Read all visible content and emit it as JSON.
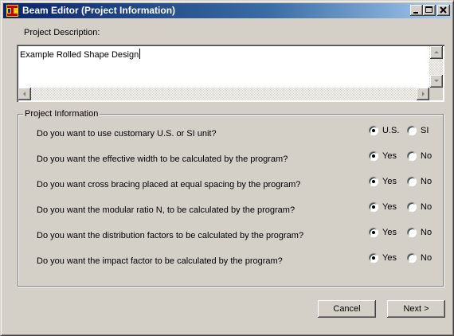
{
  "window": {
    "title": "Beam Editor (Project Information)",
    "icons": {
      "app": "beam-app-icon",
      "minimize": "minimize-icon",
      "maximize": "maximize-icon",
      "close": "close-icon"
    }
  },
  "project_description": {
    "label": "Project Description:",
    "value": "Example Rolled Shape Design"
  },
  "project_information": {
    "group_title": "Project Information",
    "questions": [
      {
        "text": "Do you want to use customary U.S. or SI unit?",
        "options": [
          "U.S.",
          "SI"
        ],
        "selected": "U.S."
      },
      {
        "text": "Do you want the effective width to be calculated by the program?",
        "options": [
          "Yes",
          "No"
        ],
        "selected": "Yes"
      },
      {
        "text": "Do you want cross bracing placed at equal spacing by the program?",
        "options": [
          "Yes",
          "No"
        ],
        "selected": "Yes"
      },
      {
        "text": "Do you want the modular ratio N, to be calculated by the program?",
        "options": [
          "Yes",
          "No"
        ],
        "selected": "Yes"
      },
      {
        "text": "Do you want the distribution factors to be calculated by the program?",
        "options": [
          "Yes",
          "No"
        ],
        "selected": "Yes"
      },
      {
        "text": "Do you want the impact factor to be calculated by the program?",
        "options": [
          "Yes",
          "No"
        ],
        "selected": "Yes"
      }
    ]
  },
  "buttons": {
    "cancel": "Cancel",
    "next": "Next >"
  }
}
